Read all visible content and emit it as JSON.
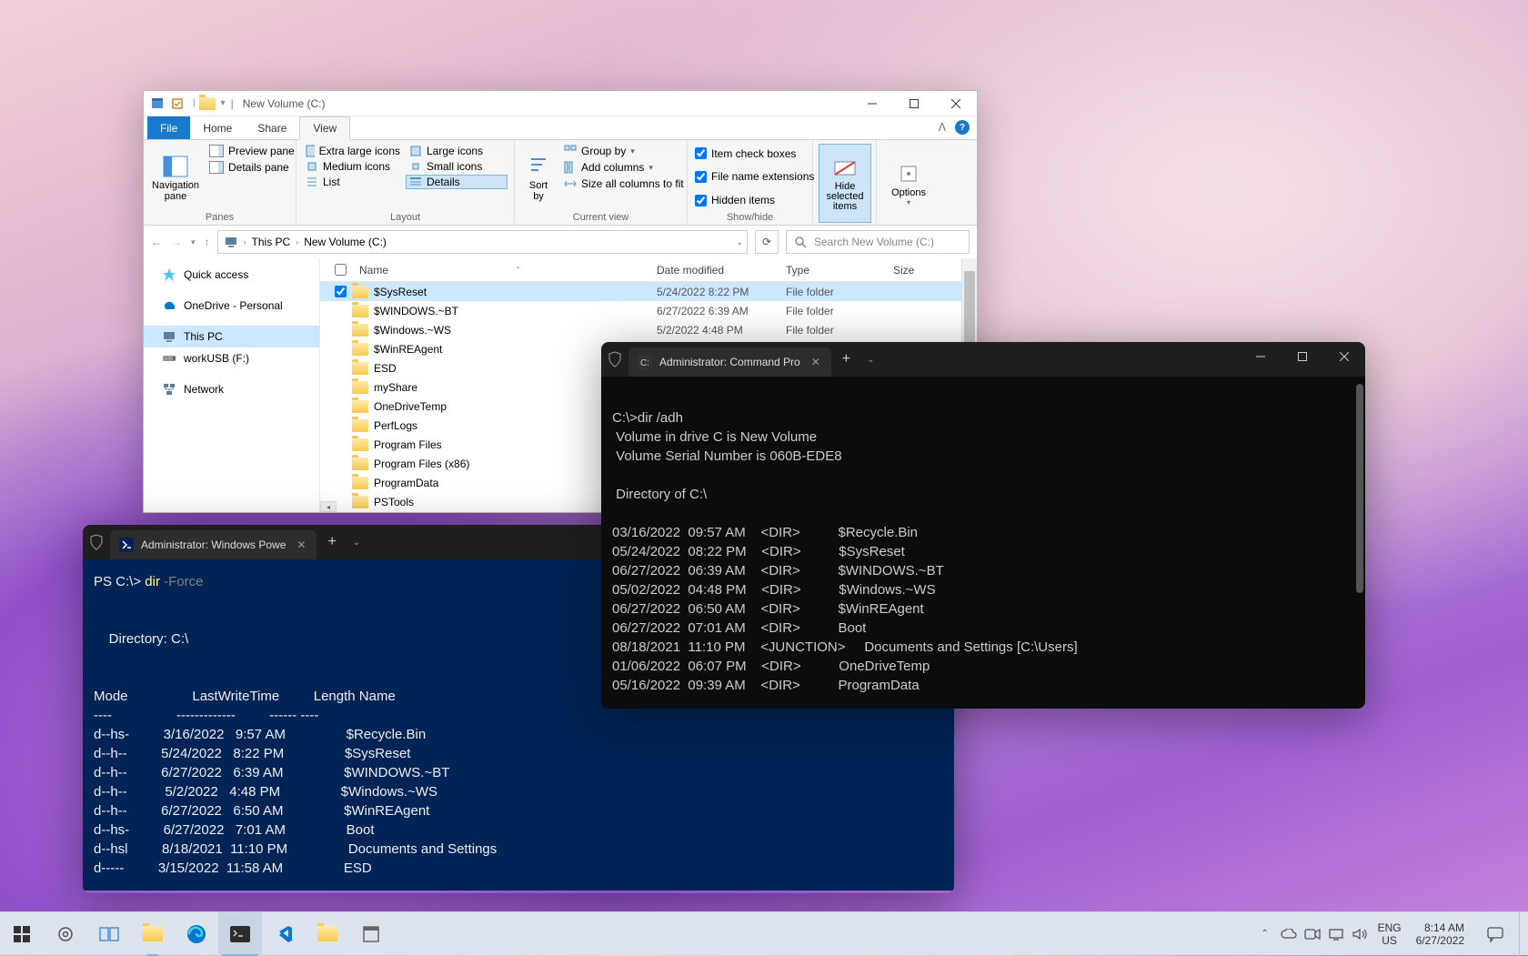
{
  "explorer": {
    "title": "New Volume (C:)",
    "tabs": {
      "file": "File",
      "home": "Home",
      "share": "Share",
      "view": "View"
    },
    "ribbon": {
      "panes": {
        "label": "Panes",
        "nav": "Navigation pane",
        "preview": "Preview pane",
        "details": "Details pane"
      },
      "layout": {
        "label": "Layout",
        "xl": "Extra large icons",
        "lg": "Large icons",
        "md": "Medium icons",
        "sm": "Small icons",
        "list": "List",
        "details": "Details"
      },
      "sort": "Sort by",
      "current": {
        "label": "Current view",
        "group": "Group by",
        "addcols": "Add columns",
        "sizeall": "Size all columns to fit"
      },
      "show": {
        "label": "Show/hide",
        "item": "Item check boxes",
        "ext": "File name extensions",
        "hidden": "Hidden items"
      },
      "hidesel": "Hide selected items",
      "options": "Options"
    },
    "breadcrumb": [
      "This PC",
      "New Volume (C:)"
    ],
    "search_placeholder": "Search New Volume (C:)",
    "sidebar": [
      {
        "icon": "star",
        "color": "#4fc3f7",
        "label": "Quick access"
      },
      {
        "icon": "cloud",
        "color": "#0078d4",
        "label": "OneDrive - Personal"
      },
      {
        "icon": "pc",
        "color": "#5a7fa0",
        "label": "This PC",
        "selected": true
      },
      {
        "icon": "usb",
        "color": "#888",
        "label": "workUSB (F:)"
      },
      {
        "icon": "net",
        "color": "#5a7fa0",
        "label": "Network"
      }
    ],
    "columns": {
      "name": "Name",
      "date": "Date modified",
      "type": "Type",
      "size": "Size"
    },
    "rows": [
      {
        "name": "$SysReset",
        "date": "5/24/2022 8:22 PM",
        "type": "File folder",
        "selected": true,
        "checked": true
      },
      {
        "name": "$WINDOWS.~BT",
        "date": "6/27/2022 6:39 AM",
        "type": "File folder"
      },
      {
        "name": "$Windows.~WS",
        "date": "5/2/2022 4:48 PM",
        "type": "File folder"
      },
      {
        "name": "$WinREAgent",
        "date": "",
        "type": ""
      },
      {
        "name": "ESD",
        "date": "",
        "type": ""
      },
      {
        "name": "myShare",
        "date": "",
        "type": ""
      },
      {
        "name": "OneDriveTemp",
        "date": "",
        "type": ""
      },
      {
        "name": "PerfLogs",
        "date": "",
        "type": ""
      },
      {
        "name": "Program Files",
        "date": "",
        "type": ""
      },
      {
        "name": "Program Files (x86)",
        "date": "",
        "type": ""
      },
      {
        "name": "ProgramData",
        "date": "",
        "type": ""
      },
      {
        "name": "PSTools",
        "date": "",
        "type": ""
      }
    ]
  },
  "cmd": {
    "tab_title": "Administrator: Command Prompt",
    "tab_title_short": "Administrator: Command Pro",
    "lines": [
      "",
      "C:\\>dir /adh",
      " Volume in drive C is New Volume",
      " Volume Serial Number is 060B-EDE8",
      "",
      " Directory of C:\\",
      "",
      "03/16/2022  09:57 AM    <DIR>          $Recycle.Bin",
      "05/24/2022  08:22 PM    <DIR>          $SysReset",
      "06/27/2022  06:39 AM    <DIR>          $WINDOWS.~BT",
      "05/02/2022  04:48 PM    <DIR>          $Windows.~WS",
      "06/27/2022  06:50 AM    <DIR>          $WinREAgent",
      "06/27/2022  07:01 AM    <DIR>          Boot",
      "08/18/2021  11:10 PM    <JUNCTION>     Documents and Settings [C:\\Users]",
      "01/06/2022  06:07 PM    <DIR>          OneDriveTemp",
      "05/16/2022  09:39 AM    <DIR>          ProgramData"
    ]
  },
  "ps": {
    "tab_title": "Administrator: Windows PowerShell",
    "tab_title_short": "Administrator: Windows Powe",
    "prompt": "PS C:\\> ",
    "cmd": "dir ",
    "flag": "-Force",
    "header": "    Directory: C:\\",
    "cols": "Mode                 LastWriteTime         Length Name",
    "sep": "----                 -------------         ------ ----",
    "rows": [
      "d--hs-         3/16/2022   9:57 AM                $Recycle.Bin",
      "d--h--         5/24/2022   8:22 PM                $SysReset",
      "d--h--         6/27/2022   6:39 AM                $WINDOWS.~BT",
      "d--h--          5/2/2022   4:48 PM                $Windows.~WS",
      "d--h--         6/27/2022   6:50 AM                $WinREAgent",
      "d--hs-         6/27/2022   7:01 AM                Boot",
      "d--hsl         8/18/2021  11:10 PM                Documents and Settings",
      "d-----         3/15/2022  11:58 AM                ESD"
    ]
  },
  "taskbar": {
    "lang1": "ENG",
    "lang2": "US",
    "time": "8:14 AM",
    "date": "6/27/2022"
  }
}
